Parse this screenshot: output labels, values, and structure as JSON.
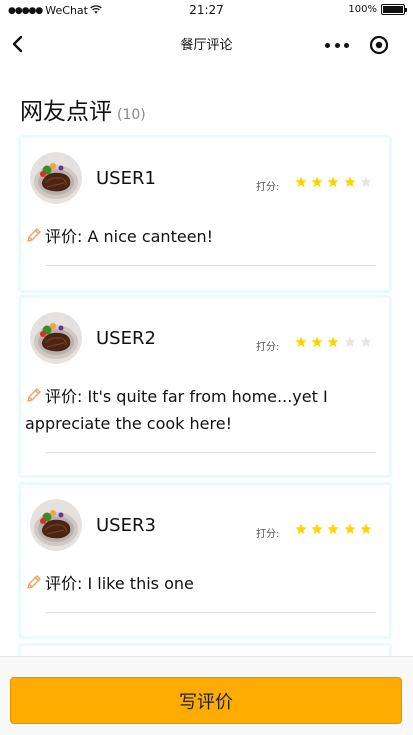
{
  "status_bar": {
    "signal_dots": "●●●●●",
    "carrier": "WeChat",
    "time": "21:27",
    "battery_percent": "100%",
    "battery_level": 1.0
  },
  "nav": {
    "title": "餐厅评论",
    "icons": [
      "chevron-left-icon",
      "more-dots-icon",
      "target-icon"
    ]
  },
  "section": {
    "title": "网友点评",
    "count": "(10)"
  },
  "rating_label": "打分:",
  "comment_prefix": "评价: ",
  "reviews": [
    {
      "user": "USER1",
      "rating": 4,
      "max_rating": 5,
      "text": "A nice canteen!"
    },
    {
      "user": "USER2",
      "rating": 3,
      "max_rating": 5,
      "text": "It's quite far from home...yet I appreciate the cook here!"
    },
    {
      "user": "USER3",
      "rating": 5,
      "max_rating": 5,
      "text": "I like this one"
    }
  ],
  "colors": {
    "star_filled": "#ffd400",
    "star_empty": "#e6e6e6",
    "card_border": "#e8fbff",
    "button_bg": "#ffab00",
    "pencil": "#f0a060"
  },
  "footer": {
    "button_label": "写评价"
  }
}
